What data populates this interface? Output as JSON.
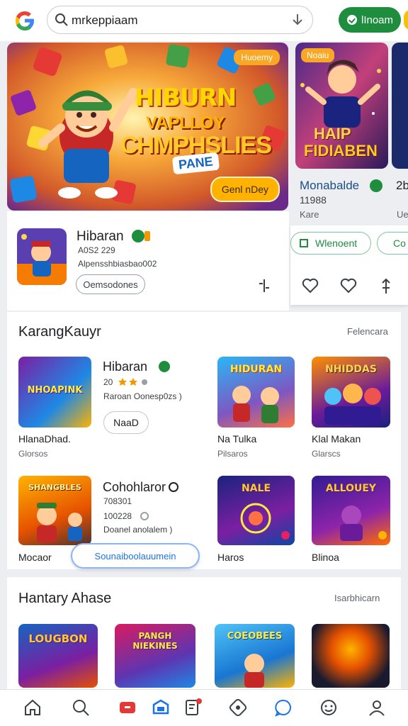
{
  "search": {
    "query": "mrkeppiaam"
  },
  "top_button": {
    "label": "lInoam"
  },
  "hero": {
    "tag": "Huoemy",
    "title_line1": "HIBURN",
    "title_line2": "VAPLLOY",
    "title_line3": "CHMPHSLIES",
    "title_badge": "PANE",
    "cta": "Genl nDey"
  },
  "side_hero": {
    "tag": "Noaiu",
    "title_line1": "HAIP",
    "title_line2": "FIDIABEN",
    "name": "Monabalde",
    "name_cut": "2b",
    "meta1": "11988",
    "meta2": "Kare",
    "meta3": "Ue"
  },
  "app": {
    "name": "Hibaran",
    "meta1": "A0S2 229",
    "meta2": "Alpensshbiasbao002",
    "chip": "Oemsodones"
  },
  "right_panel": {
    "install_label": "Wlenoent",
    "install2_label": "Co"
  },
  "section1": {
    "title": "KarangKauyr",
    "more": "Felencara",
    "row1": {
      "tile1": {
        "art": "NHOAPINK",
        "name": "HlanaDhad.",
        "sub": "Glorsos"
      },
      "mid": {
        "name": "Hibaran",
        "line1": "20",
        "line2": "Raroan Oonesp0zs )",
        "chip": "NaaD"
      },
      "tile2": {
        "art": "HIDURAN",
        "name": "Na Tulka",
        "sub": "Pilsaros"
      },
      "tile3": {
        "art": "NHIDDAS",
        "name": "Klal Makan",
        "sub": "Glarscs"
      }
    },
    "row2": {
      "tile1": {
        "art": "SHANGBLES",
        "name": "Mocaor",
        "sub": ""
      },
      "mid": {
        "name": "Cohohlaror",
        "line1": "708301",
        "line2": "100228",
        "line3": "Doanel anolalem )"
      },
      "tile2": {
        "art": "NALE",
        "name": "Haros",
        "sub": ""
      },
      "tile3": {
        "art": "ALLOUEY",
        "name": "Blinoa",
        "sub": ""
      }
    },
    "floating_button": "Sounaiboolauumein"
  },
  "section2": {
    "title": "Hantary Ahase",
    "more": "Isarbhicarn",
    "tiles": [
      "LOUGBON",
      "PANGH NIEKINES",
      "COEOBEES",
      ""
    ]
  },
  "colors": {
    "accent_green": "#1e8e3e",
    "link_blue": "#1a73e8",
    "hero_orange": "#f9a825"
  },
  "nav": [
    "home-icon",
    "search-icon",
    "games-icon",
    "apps-icon",
    "books-icon",
    "offers-icon",
    "chat-icon",
    "kids-icon",
    "profile-icon"
  ]
}
